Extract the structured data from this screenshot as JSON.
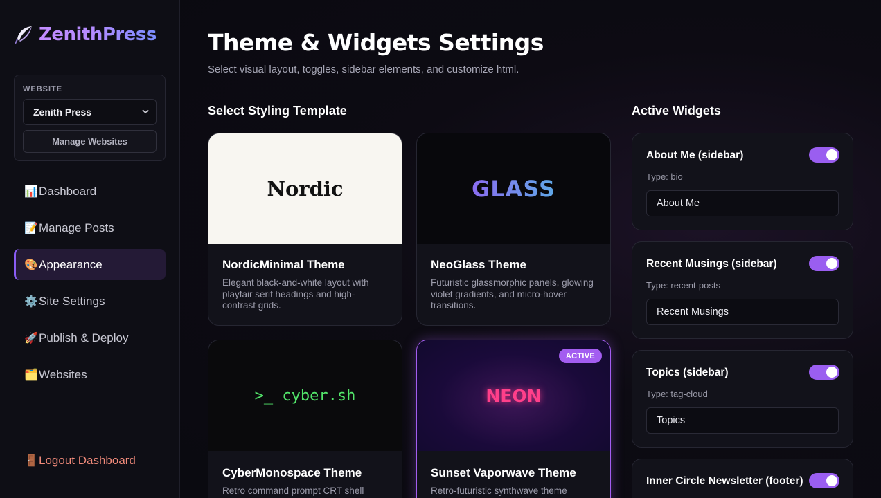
{
  "brand": {
    "name": "ZenithPress"
  },
  "website_box": {
    "label": "WEBSITE",
    "selected": "Zenith Press",
    "manage_label": "Manage Websites"
  },
  "nav": {
    "items": [
      {
        "icon": "📊",
        "label": "Dashboard"
      },
      {
        "icon": "📝",
        "label": "Manage Posts"
      },
      {
        "icon": "🎨",
        "label": "Appearance"
      },
      {
        "icon": "⚙️",
        "label": "Site Settings"
      },
      {
        "icon": "🚀",
        "label": "Publish & Deploy"
      },
      {
        "icon": "🗂️",
        "label": "Websites"
      }
    ],
    "logout": {
      "icon": "🚪",
      "label": "Logout Dashboard"
    }
  },
  "page": {
    "title": "Theme & Widgets Settings",
    "subtitle": "Select visual layout, toggles, sidebar elements, and customize html."
  },
  "templates": {
    "heading": "Select Styling Template",
    "items": [
      {
        "preview": "Nordic",
        "name": "NordicMinimal Theme",
        "desc": "Elegant black-and-white layout with playfair serif headings and high-contrast grids."
      },
      {
        "preview": "GLASS",
        "name": "NeoGlass Theme",
        "desc": "Futuristic glassmorphic panels, glowing violet gradients, and micro-hover transitions."
      },
      {
        "preview": ">_ cyber.sh",
        "name": "CyberMonospace Theme",
        "desc": "Retro command prompt CRT shell"
      },
      {
        "preview": "NEON",
        "name": "Sunset Vaporwave Theme",
        "desc": "Retro-futuristic synthwave theme",
        "badge": "ACTIVE"
      }
    ]
  },
  "widgets": {
    "heading": "Active Widgets",
    "items": [
      {
        "name": "About Me (sidebar)",
        "type": "Type: bio",
        "value": "About Me",
        "enabled": true
      },
      {
        "name": "Recent Musings (sidebar)",
        "type": "Type: recent-posts",
        "value": "Recent Musings",
        "enabled": true
      },
      {
        "name": "Topics (sidebar)",
        "type": "Type: tag-cloud",
        "value": "Topics",
        "enabled": true
      },
      {
        "name": "Inner Circle Newsletter (footer)",
        "enabled": true
      }
    ]
  },
  "colors": {
    "accent": "#a35df0",
    "background": "#0b0b12"
  }
}
